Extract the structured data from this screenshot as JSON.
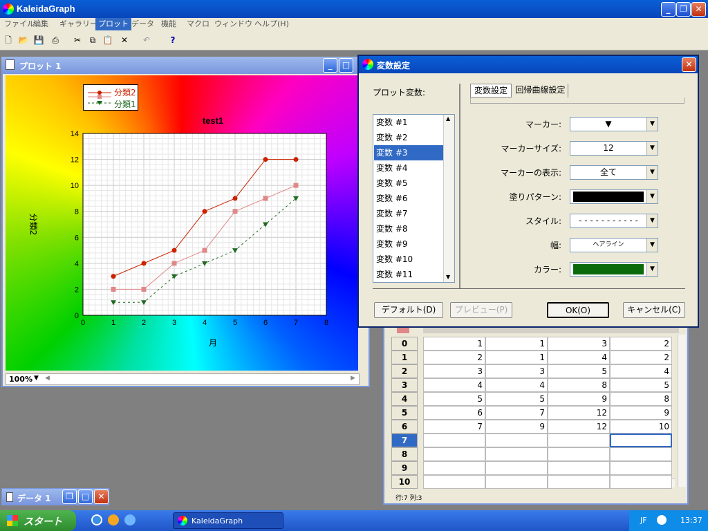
{
  "app": {
    "title": "KaleidaGraph"
  },
  "menu": [
    "ファイル",
    "編集",
    "ギャラリー",
    "プロット",
    "データ",
    "機能",
    "マクロ",
    "ウィンドウ",
    "ヘルプ(H)"
  ],
  "plot_window": {
    "title": "プロット 1",
    "zoom": "100%"
  },
  "data_window": {
    "title": "データ 1",
    "status": "行:7 列:3"
  },
  "dialog": {
    "title": "変数設定",
    "plot_vars_label": "プロット変数:",
    "tabs": [
      "変数設定",
      "回帰曲線設定"
    ],
    "vars": [
      "変数 #1",
      "変数 #2",
      "変数 #3",
      "変数 #4",
      "変数 #5",
      "変数 #6",
      "変数 #7",
      "変数 #8",
      "変数 #9",
      "変数 #10",
      "変数 #11"
    ],
    "fields": [
      {
        "label": "マーカー:",
        "value": "▼"
      },
      {
        "label": "マーカーサイズ:",
        "value": "12"
      },
      {
        "label": "マーカーの表示:",
        "value": "全て"
      },
      {
        "label": "塗りパターン:",
        "value": ""
      },
      {
        "label": "スタイル:",
        "value": "- - - - - - - - - - -"
      },
      {
        "label": "幅:",
        "value": "ヘアライン"
      },
      {
        "label": "カラー:",
        "value": ""
      }
    ],
    "buttons": {
      "default": "デフォルト(D)",
      "preview": "プレビュー(P)",
      "ok": "OK(O)",
      "cancel": "キャンセル(C)"
    }
  },
  "table": {
    "row_numbers": [
      "0",
      "1",
      "2",
      "3",
      "4",
      "5",
      "6",
      "7",
      "8",
      "9",
      "10"
    ],
    "rows": [
      [
        "1",
        "1",
        "3",
        "2"
      ],
      [
        "2",
        "1",
        "4",
        "2"
      ],
      [
        "3",
        "3",
        "5",
        "4"
      ],
      [
        "4",
        "4",
        "8",
        "5"
      ],
      [
        "5",
        "5",
        "9",
        "8"
      ],
      [
        "6",
        "7",
        "12",
        "9"
      ],
      [
        "7",
        "9",
        "12",
        "10"
      ]
    ]
  },
  "taskbar": {
    "start": "スタート",
    "app": "KaleidaGraph",
    "lang": "JF",
    "time": "13:37"
  },
  "colors": {
    "series1": "#1f6a1f",
    "series2": "#cc2200",
    "series3": "#e08888",
    "fill": "#000000",
    "color": "#0a6a0a"
  },
  "chart_data": {
    "type": "line",
    "title": "test1",
    "xlabel": "月",
    "ylabel": "分類2",
    "xlim": [
      0,
      8
    ],
    "ylim": [
      0,
      14
    ],
    "xticks": [
      "0",
      "1",
      "2",
      "3",
      "4",
      "5",
      "6",
      "7",
      "8"
    ],
    "yticks": [
      "0",
      "2",
      "4",
      "6",
      "8",
      "10",
      "12",
      "14"
    ],
    "x": [
      1,
      2,
      3,
      4,
      5,
      6,
      7
    ],
    "series": [
      {
        "name": "分類2",
        "values": [
          3,
          4,
          5,
          8,
          9,
          12,
          12
        ]
      },
      {
        "values": [
          2,
          2,
          4,
          5,
          8,
          9,
          10
        ]
      },
      {
        "name": "分類1",
        "values": [
          1,
          1,
          3,
          4,
          5,
          7,
          9
        ]
      }
    ]
  }
}
